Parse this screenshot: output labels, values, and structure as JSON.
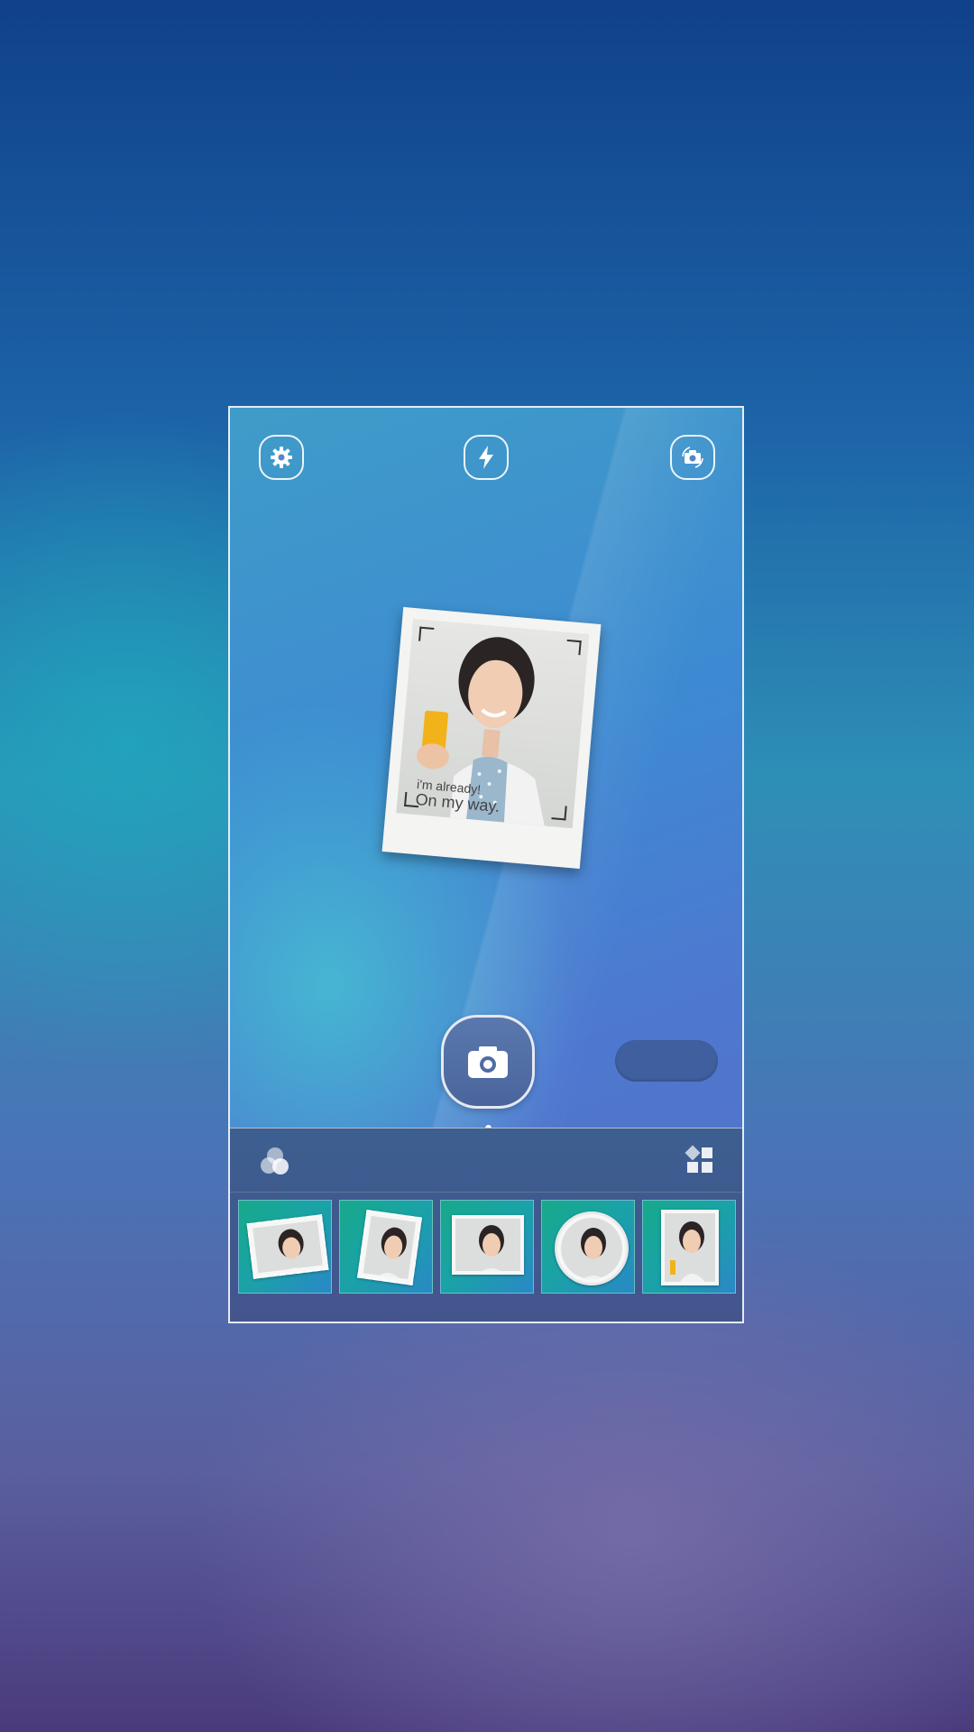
{
  "camera": {
    "top_bar": {
      "settings_icon": "gear-icon",
      "flash_icon": "flash-icon",
      "switch_camera_icon": "camera-switch-icon"
    },
    "preview": {
      "caption_line1": "i'm already!",
      "caption_line2": "On my way."
    },
    "shutter_icon": "camera-icon",
    "panel": {
      "tab_filters_icon": "filters-icon",
      "tab_layouts_icon": "layout-grid-icon",
      "thumbnails": [
        {
          "style": "stamp-tilted-left"
        },
        {
          "style": "stamp-tilted-right"
        },
        {
          "style": "square-frame"
        },
        {
          "style": "round-frame"
        },
        {
          "style": "polaroid-caption"
        }
      ]
    }
  },
  "colors": {
    "accent": "#4a659c",
    "panel": "#3f5a8e",
    "thumb_bg": "#1aa2a8"
  }
}
